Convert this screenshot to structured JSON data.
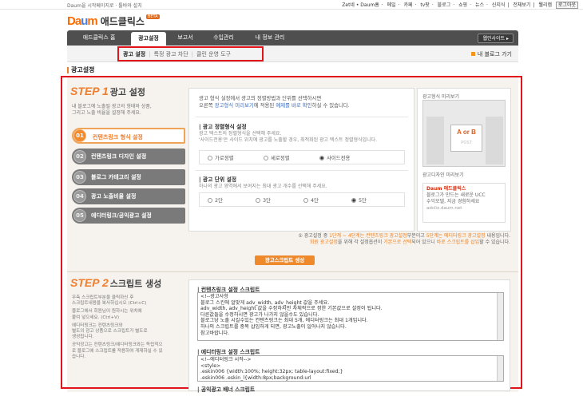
{
  "util": {
    "left": "Daum을 시작페이지로 · 툴바와 설치",
    "right_items": [
      "Zet네 • Daum홈",
      "메일",
      "카페",
      "tv팟",
      "블로그",
      "쇼핑",
      "뉴스",
      "신지식",
      "전체보기",
      "웰리캠"
    ],
    "logout": "로그아웃"
  },
  "logo": {
    "mark_a": "Da",
    "mark_b": "m",
    "name": "애드클릭스",
    "beta": "BETA"
  },
  "gnb": {
    "tabs": [
      "애드클릭스 홈",
      "광고설정",
      "보고서",
      "수입관리",
      "내 정보 관리"
    ],
    "active": 1,
    "help": "웹인사이트 ▸"
  },
  "subnav": {
    "items": [
      "광고 설정",
      "특정 광고 차단",
      "클린 운영 도구"
    ],
    "back": "내 블로그 가기"
  },
  "page_title": "광고설정",
  "step1": {
    "prefix": "STEP",
    "num": "1",
    "title": "광고 설정",
    "desc": [
      "내 블로그에 노출될 광고의 형태와 상품,",
      "그리고 노출 비율을 설정해 주세요."
    ],
    "menu": [
      {
        "num": "01",
        "label": "컨텐츠링크 형식 설정"
      },
      {
        "num": "02",
        "label": "컨텐츠링크 디자인 설정"
      },
      {
        "num": "03",
        "label": "블로그 카테고리 설정"
      },
      {
        "num": "04",
        "label": "광고 노출비율 설정"
      },
      {
        "num": "05",
        "label": "에디터링크/공익광고 설정"
      }
    ]
  },
  "card": {
    "intro1": "광고 형식 설정에서 광고의 정렬방법과 단위를 선택하시면",
    "intro2a": "오른쪽 ",
    "intro2b": "광고형식 미리보기",
    "intro2c": "에 적용된 ",
    "intro2d": "예제를 바로 확인",
    "intro2e": "하실 수 있습니다.",
    "sec1_title": "| 광고 정렬형식 설정",
    "sec1_sub1": "광고 텍스트의 정렬형식을 선택해 주세요.",
    "sec1_sub2": "'사이드전용'은 사이드 위치에 광고를 노출할 경우, 최적화된 광고 텍스트 정렬형식입니다.",
    "align_opts": [
      "가로정렬",
      "세로정렬",
      "사이드전용"
    ],
    "sec2_title": "| 광고 단위 설정",
    "sec2_sub": "하나의 광고 영역에서 보여지는 최대 광고 개수를 선택해 주세요.",
    "unit_opts": [
      "2단",
      "3단",
      "4단",
      "5단"
    ]
  },
  "preview": {
    "title": "광고형식 미리보기",
    "ab": "A or B",
    "post": "POST",
    "design_label": "광고디자인 미리보기",
    "ad_title": "Daum 애드클릭스",
    "ad_line1": "블로그가 만드는 새로운 UCC",
    "ad_line2": "수익모델, 지금 경험하세요",
    "ad_url": "adclix.daum.net"
  },
  "notice": {
    "l1a": "① 광고설정 중 ",
    "l1b": "1단계 ~ 4단계는 컨텐츠링크 광고설정",
    "l1c": "부분이고 ",
    "l1d": "5단계는 에디터링크 광고설정",
    "l1e": " 내용입니다.",
    "l2a": "회원 광고설정",
    "l2b": "을 위해 각 설정옵션이 ",
    "l2c": "기본으로 선택",
    "l2d": "되어 있으니 ",
    "l2e": "바로 스크립트를 삽입",
    "l2f": "할 수 있습니다."
  },
  "gen_button": "광고스크립트 생성",
  "step2": {
    "prefix": "STEP",
    "num": "2",
    "title": "스크립트 생성",
    "desc": [
      "우측 스크립트부분을 클릭하신 후",
      "스크립트내용을 복사하십시오 (Ctrl+C)",
      "",
      "블로그에서 회원님이 원하시는 위치에",
      "붙여 넣으세요. (Ctrl+V)",
      "",
      "에디터링크는 컨텐츠링크와",
      "별도의 광고 상품으로 스크립트가 별도로",
      "생성됩니다.",
      "",
      "공익광고는 컨텐츠링크/에디터링크와는 독립적으",
      "로 블로그에 스크립트를 적용하여 게재하실 수 있",
      "습니다."
    ]
  },
  "scripts": {
    "s1_title": "| 컨텐츠링크 설정 스크립트",
    "s1_lines": [
      "<!--광고사항",
      "블로그 스킨에 알맞게 adv_width, adv_height 값을 주세요.",
      "adv_width, adv_height 값을 수정하지만 자체적으로 정한 기본값으로 설정이 됩니다.",
      "다른값들을 수정하시면 광고가 나가지 않을수도 있습니다.",
      "블로그당 노출 시킬수있는 컨텐츠링크는 최대 5개, 에디터링크는 최대 1개입니다.",
      "하나의 스크립트를 중복 삽입하게 되면, 광고노출이 일어나지 않습니다.",
      "참고바랍니다."
    ],
    "s2_title": "| 에디터링크 설정 스크립트",
    "s2_lines": [
      "<!--에디터링크 시작-->",
      "<style>",
      ".eskin006 {width:100%; height:32px; table-layout:fixed;}",
      ".eskin006 .eskin_l{width:8px;background:url"
    ],
    "s3_title": "| 공익광고 배너 스크립트"
  }
}
